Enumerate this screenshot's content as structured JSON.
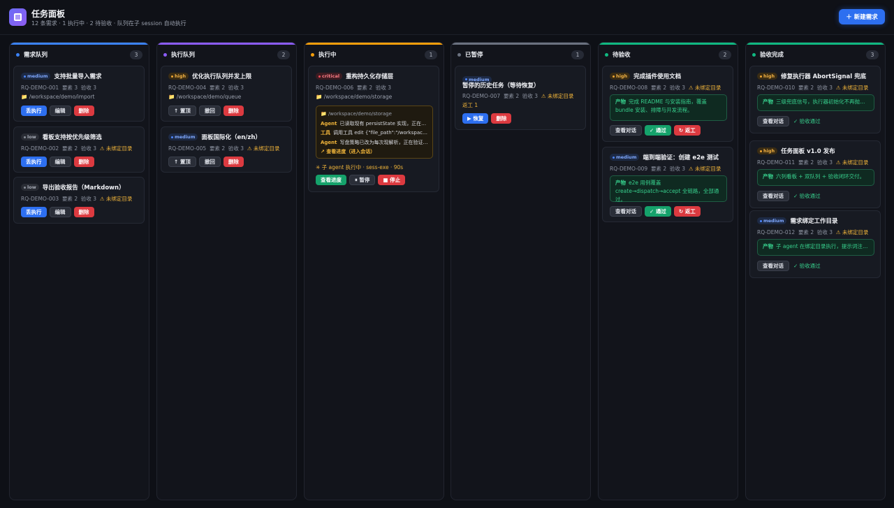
{
  "header": {
    "title": "任务面板",
    "subtitle": "12 条需求 · 1 执行中 · 2 待验收 · 队列在子 session 自动执行",
    "new_button": "＋ 新建需求"
  },
  "colors": {
    "queue": "#3b82f6",
    "exec": "#8b5cf6",
    "running": "#f59e0b",
    "paused": "#6b7280",
    "review": "#10b981",
    "done": "#10b981"
  },
  "columns": [
    {
      "title": "需求队列",
      "count": "3",
      "cards": [
        {
          "priority": "medium",
          "title": "支持批量导入需求",
          "id": "RQ-DEMO-001",
          "req": "要素 3",
          "acc": "验收 3",
          "path": "📁 /workspace/demo/import",
          "b1": "丢执行",
          "b2": "编辑",
          "b3": "删除"
        },
        {
          "priority": "low",
          "title": "看板支持按优先级筛选",
          "id": "RQ-DEMO-002",
          "req": "要素 2",
          "acc": "验收 3",
          "warn": "⚠ 未绑定目录",
          "b1": "丢执行",
          "b2": "编辑",
          "b3": "删除"
        },
        {
          "priority": "low",
          "title": "导出验收报告（Markdown）",
          "id": "RQ-DEMO-003",
          "req": "要素 2",
          "acc": "验收 3",
          "warn": "⚠ 未绑定目录",
          "b1": "丢执行",
          "b2": "编辑",
          "b3": "删除"
        }
      ]
    },
    {
      "title": "执行队列",
      "count": "2",
      "cards": [
        {
          "priority": "high",
          "title": "优化执行队列并发上限",
          "id": "RQ-DEMO-004",
          "req": "要素 2",
          "acc": "验收 3",
          "path": "📁 /workspace/demo/queue",
          "b1": "↑ 置顶",
          "b2": "撤回",
          "b3": "删除"
        },
        {
          "priority": "medium",
          "title": "面板国际化（en/zh）",
          "id": "RQ-DEMO-005",
          "req": "要素 2",
          "acc": "验收 3",
          "warn": "⚠ 未绑定目录",
          "b1": "↑ 置顶",
          "b2": "撤回",
          "b3": "删除"
        }
      ]
    },
    {
      "title": "执行中",
      "count": "1",
      "cards": [
        {
          "priority": "critical",
          "title": "重构持久化存储层",
          "id": "RQ-DEMO-006",
          "req": "要素 2",
          "acc": "验收 3",
          "path": "📁 /workspace/demo/storage",
          "log_path": "📁 /workspace/demo/storage",
          "log": [
            {
              "tag": "Agent",
              "text": "已读取现有 persistState 实现，正在分析调用点"
            },
            {
              "tag": "工具",
              "text": "调用工具 edit {\"file_path\":\"/workspace/demo/storage\"}"
            },
            {
              "tag": "Agent",
              "text": "写盘策略已改为每次现解析，正在验证回归"
            }
          ],
          "log_link": "↗ 查看进度（进入会话）",
          "run": "✳ 子 agent 执行中 · sess-exe · 90s",
          "b1": "查看进度",
          "b2": "⏸ 暂停",
          "b3": "■ 停止"
        }
      ]
    },
    {
      "title": "已暂停",
      "count": "1",
      "cards": [
        {
          "priority": "medium",
          "title": "暂停的历史任务（等待恢复）",
          "id": "RQ-DEMO-007",
          "req": "要素 2",
          "acc": "验收 3",
          "warn": "⚠ 未绑定目录",
          "returned": "返工 1",
          "b1": "▶ 恢复",
          "b2": "删除"
        }
      ]
    },
    {
      "title": "待验收",
      "count": "2",
      "cards": [
        {
          "priority": "high",
          "title": "完成插件使用文档",
          "id": "RQ-DEMO-008",
          "req": "要素 2",
          "acc": "验收 3",
          "warn": "⚠ 未绑定目录",
          "out_label": "产物",
          "out_text": "完成 README 与安装指南，覆盖 bundle 安装、排障与开发流程。",
          "b1": "查看对话",
          "b2": "✓ 通过",
          "b3": "↻ 返工"
        },
        {
          "priority": "medium",
          "title": "端到端验证：创建 e2e 测试",
          "id": "RQ-DEMO-009",
          "req": "要素 2",
          "acc": "验收 3",
          "warn": "⚠ 未绑定目录",
          "out_label": "产物",
          "out_text": "e2e 用例覆盖 create→dispatch→accept 全链路，全部通过。",
          "b1": "查看对话",
          "b2": "✓ 通过",
          "b3": "↻ 返工"
        }
      ]
    },
    {
      "title": "验收完成",
      "count": "3",
      "cards": [
        {
          "priority": "high",
          "title": "修复执行器 AbortSignal 兜底",
          "id": "RQ-DEMO-010",
          "req": "要素 2",
          "acc": "验收 3",
          "warn": "⚠ 未绑定目录",
          "out_label": "产物",
          "out_text": "三级兜底信号，执行器初始化不再抛错。",
          "b1": "查看对话",
          "pass": "✓ 验收通过"
        },
        {
          "priority": "high",
          "title": "任务面板 v1.0 发布",
          "id": "RQ-DEMO-011",
          "req": "要素 2",
          "acc": "验收 3",
          "warn": "⚠ 未绑定目录",
          "out_label": "产物",
          "out_text": "六列看板 + 双队列 + 验收闭环交付。",
          "b1": "查看对话",
          "pass": "✓ 验收通过"
        },
        {
          "priority": "medium",
          "title": "需求绑定工作目录",
          "id": "RQ-DEMO-012",
          "req": "要素 2",
          "acc": "验收 3",
          "warn": "⚠ 未绑定目录",
          "out_label": "产物",
          "out_text": "子 agent 在绑定目录执行，提示词注入目录。",
          "b1": "查看对话",
          "pass": "✓ 验收通过"
        }
      ]
    }
  ]
}
